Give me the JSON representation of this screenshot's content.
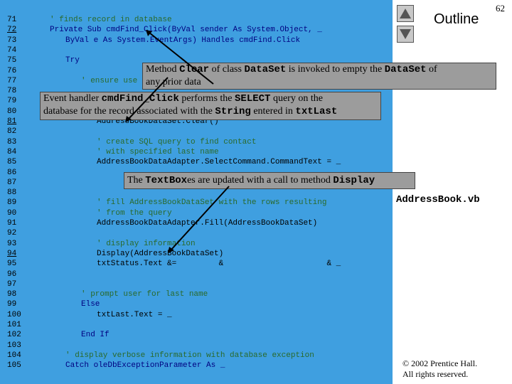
{
  "slide": {
    "page_number": "62",
    "outline_label": "Outline",
    "file_name": "AddressBook.vb",
    "copyright_line1": "© 2002 Prentice Hall.",
    "copyright_line2": "All rights reserved."
  },
  "code_lines": [
    {
      "num": "71",
      "text": "' finds record in database",
      "indent": 70,
      "style": "cm",
      "underline": false
    },
    {
      "num": "72",
      "text": "Private Sub cmdFind_Click(ByVal sender As System.Object, _",
      "indent": 70,
      "style": "kw",
      "underline": true
    },
    {
      "num": "73",
      "text": "ByVal e As System.EventArgs) Handles cmdFind.Click",
      "indent": 92,
      "style": "kw",
      "underline": false
    },
    {
      "num": "74",
      "text": "",
      "indent": 70,
      "style": "",
      "underline": false
    },
    {
      "num": "75",
      "text": "Try",
      "indent": 92,
      "style": "kw",
      "underline": false
    },
    {
      "num": "76",
      "text": "",
      "indent": 70,
      "style": "",
      "underline": false
    },
    {
      "num": "77",
      "text": "' ensure use",
      "indent": 114,
      "style": "cm",
      "underline": false
    },
    {
      "num": "78",
      "text": "",
      "indent": 70,
      "style": "",
      "underline": false
    },
    {
      "num": "79",
      "text": "",
      "indent": 70,
      "style": "",
      "underline": false
    },
    {
      "num": "80",
      "text": "",
      "indent": 70,
      "style": "",
      "underline": false
    },
    {
      "num": "81",
      "text": "AddressBookDataSet.Clear()",
      "indent": 136,
      "style": "",
      "underline": true
    },
    {
      "num": "82",
      "text": "",
      "indent": 70,
      "style": "",
      "underline": false
    },
    {
      "num": "83",
      "text": "' create SQL query to find contact",
      "indent": 136,
      "style": "cm",
      "underline": false
    },
    {
      "num": "84",
      "text": "' with specified last name",
      "indent": 136,
      "style": "cm",
      "underline": false
    },
    {
      "num": "85",
      "text": "AddressBookDataAdapter.SelectCommand.CommandText = _",
      "indent": 136,
      "style": "",
      "underline": false
    },
    {
      "num": "86",
      "text": "",
      "indent": 70,
      "style": "",
      "underline": false
    },
    {
      "num": "87",
      "text": "",
      "indent": 70,
      "style": "",
      "underline": false
    },
    {
      "num": "88",
      "text": "",
      "indent": 70,
      "style": "",
      "underline": false
    },
    {
      "num": "89",
      "text": "' fill AddressBookDataSet with the rows resulting",
      "indent": 136,
      "style": "cm",
      "underline": false
    },
    {
      "num": "90",
      "text": "' from the query",
      "indent": 136,
      "style": "cm",
      "underline": false
    },
    {
      "num": "91",
      "text": "AddressBookDataAdapter.Fill(AddressBookDataSet)",
      "indent": 136,
      "style": "",
      "underline": false
    },
    {
      "num": "92",
      "text": "",
      "indent": 70,
      "style": "",
      "underline": false
    },
    {
      "num": "93",
      "text": "' display information",
      "indent": 136,
      "style": "cm",
      "underline": false
    },
    {
      "num": "94",
      "text": "Display(AddressBookDataSet)",
      "indent": 136,
      "style": "",
      "underline": true
    },
    {
      "num": "95",
      "text": "txtStatus.Text &=         &                      & _",
      "indent": 136,
      "style": "",
      "underline": false
    },
    {
      "num": "96",
      "text": "",
      "indent": 70,
      "style": "",
      "underline": false
    },
    {
      "num": "97",
      "text": "",
      "indent": 70,
      "style": "",
      "underline": false
    },
    {
      "num": "98",
      "text": "' prompt user for last name",
      "indent": 114,
      "style": "cm",
      "underline": false
    },
    {
      "num": "99",
      "text": "Else",
      "indent": 114,
      "style": "kw",
      "underline": false
    },
    {
      "num": "100",
      "text": "txtLast.Text = _",
      "indent": 136,
      "style": "",
      "underline": false
    },
    {
      "num": "101",
      "text": "",
      "indent": 70,
      "style": "",
      "underline": false
    },
    {
      "num": "102",
      "text": "End If",
      "indent": 114,
      "style": "kw",
      "underline": false
    },
    {
      "num": "103",
      "text": "",
      "indent": 70,
      "style": "",
      "underline": false
    },
    {
      "num": "104",
      "text": "' display verbose information with database exception",
      "indent": 92,
      "style": "cm",
      "underline": false
    },
    {
      "num": "105",
      "text": "Catch oleDbExceptionParameter As _",
      "indent": 92,
      "style": "kw",
      "underline": false
    }
  ],
  "callouts": {
    "clear": {
      "a": "Method ",
      "b": "Clear",
      "c": " of class ",
      "d": "DataSet",
      "e": " is invoked to empty the ",
      "f": "DataSet",
      "g": " of",
      "line2": "any prior data"
    },
    "find": {
      "a": "Event handler ",
      "b": "cmdFind_Click",
      "c": " performs the ",
      "d": "SELECT",
      "e": " query on the",
      "f": "database for the record associated with the ",
      "g": "String",
      "h": " entered in ",
      "i": "txtLast"
    },
    "display": {
      "a": "The ",
      "b": "TextBox",
      "c": "es are updated with a call to method ",
      "d": "Display"
    }
  }
}
